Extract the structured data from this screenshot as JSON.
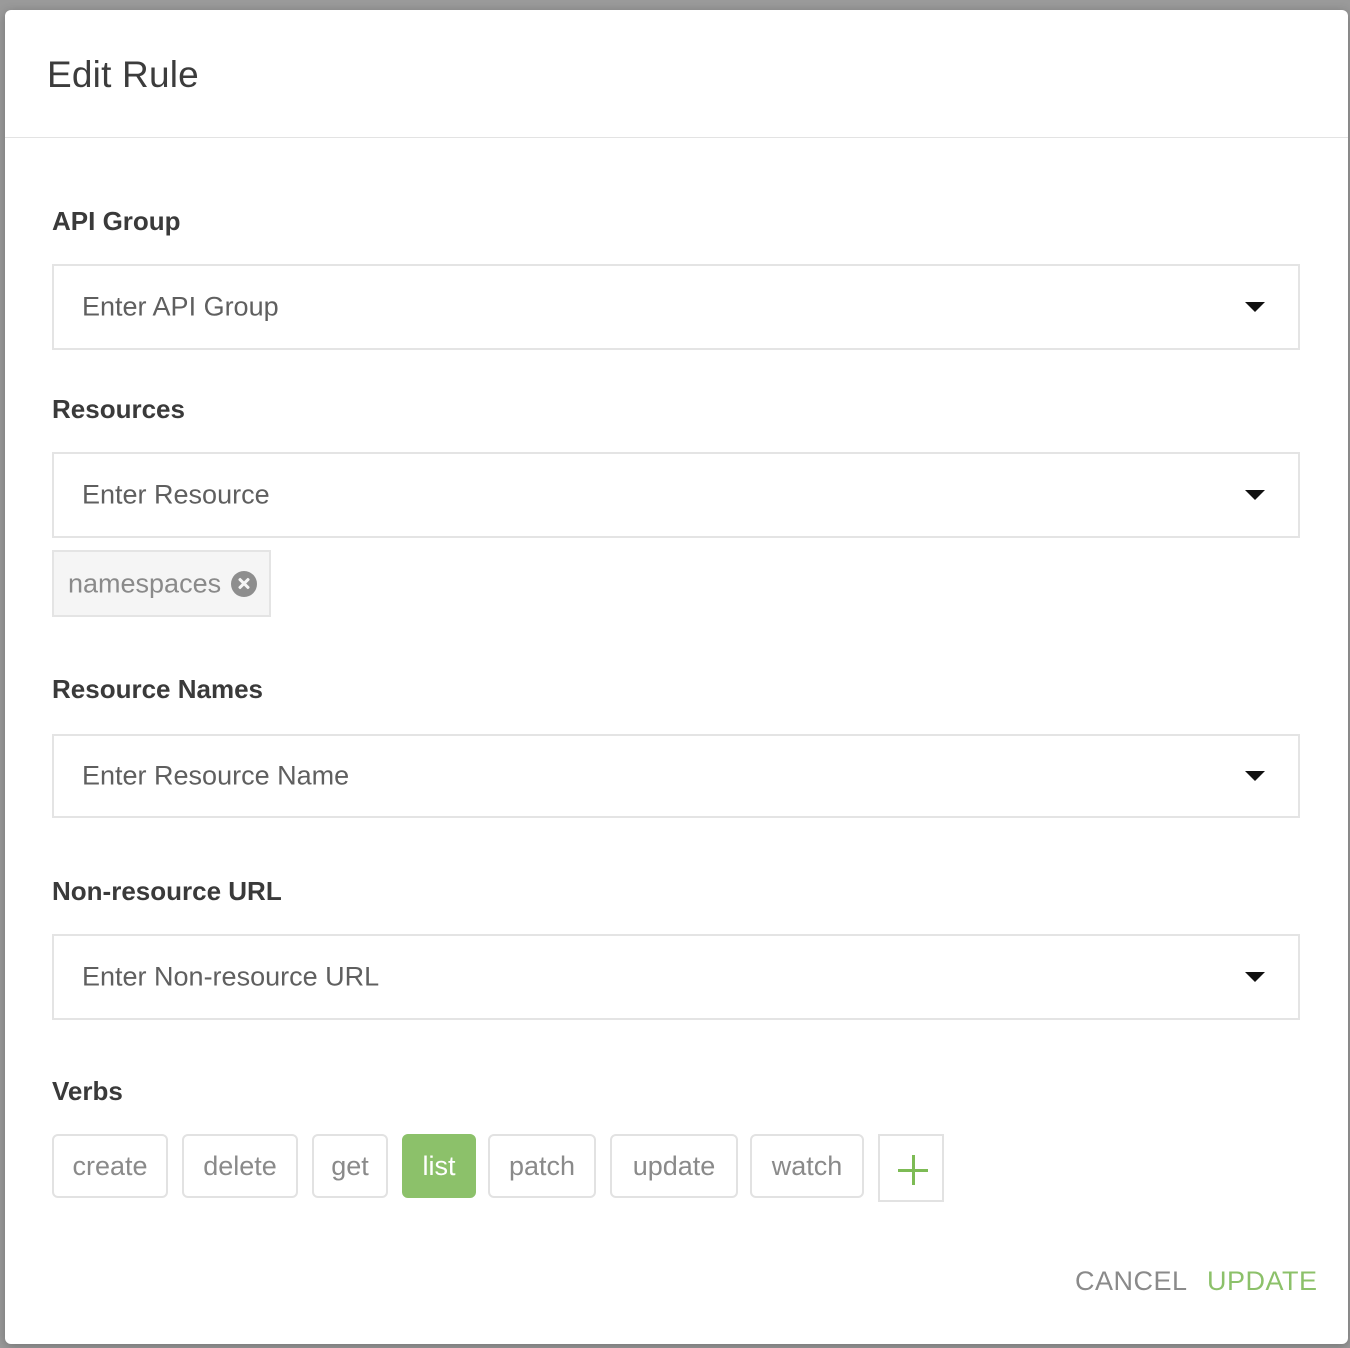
{
  "modal": {
    "title": "Edit Rule"
  },
  "api_group": {
    "label": "API Group",
    "placeholder": "Enter API Group"
  },
  "resources": {
    "label": "Resources",
    "placeholder": "Enter Resource",
    "chips": [
      "namespaces"
    ]
  },
  "resource_names": {
    "label": "Resource Names",
    "placeholder": "Enter Resource Name"
  },
  "non_resource_url": {
    "label": "Non-resource URL",
    "placeholder": "Enter Non-resource URL"
  },
  "verbs": {
    "label": "Verbs",
    "items": [
      {
        "label": "create",
        "selected": false
      },
      {
        "label": "delete",
        "selected": false
      },
      {
        "label": "get",
        "selected": false
      },
      {
        "label": "list",
        "selected": true
      },
      {
        "label": "patch",
        "selected": false
      },
      {
        "label": "update",
        "selected": false
      },
      {
        "label": "watch",
        "selected": false
      }
    ],
    "add_icon": "plus-icon"
  },
  "footer": {
    "cancel_label": "CANCEL",
    "update_label": "UPDATE"
  },
  "colors": {
    "accent": "#8cc16a",
    "overlay": "#9a9a9a",
    "muted_text": "#8a8a8a"
  }
}
